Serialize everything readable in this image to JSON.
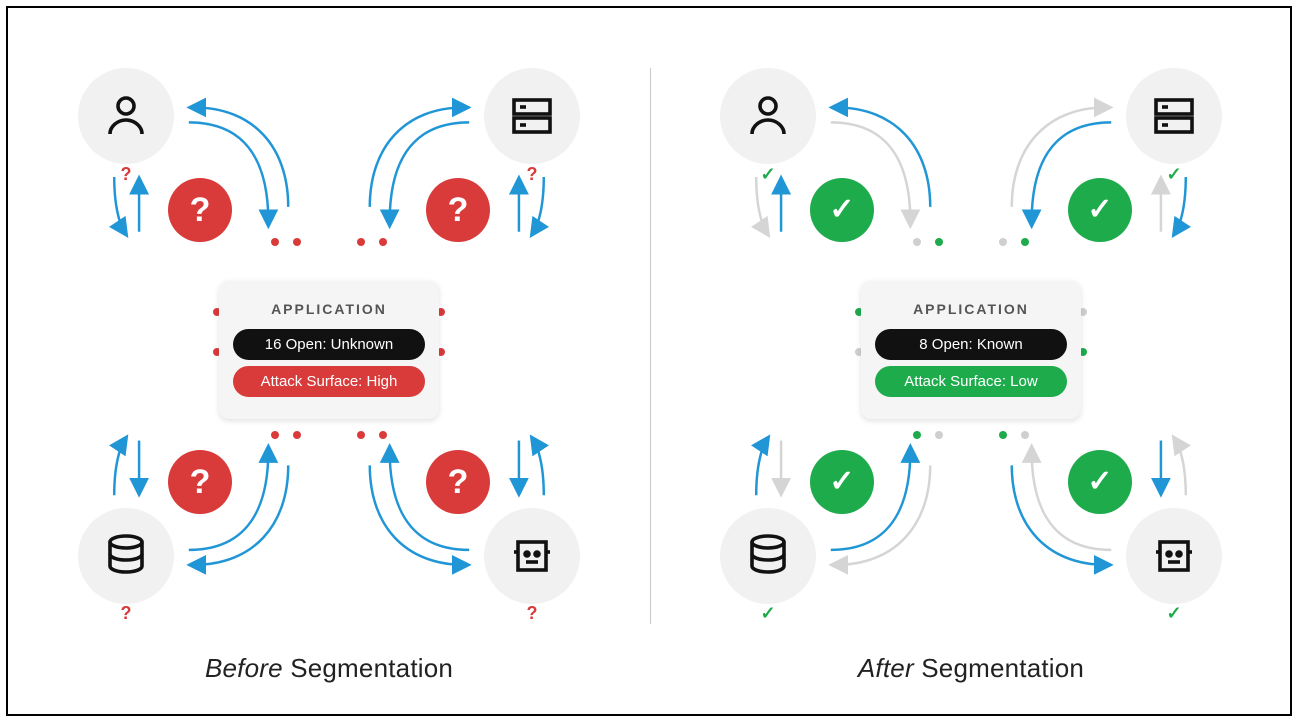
{
  "before": {
    "caption_prefix": "Before",
    "caption_rest": " Segmentation",
    "card_title": "APPLICATION",
    "pill1": "16 Open: Unknown",
    "pill2": "Attack Surface: High",
    "accent": "red",
    "sub_mark": "?",
    "badge_mark": "?",
    "nodes": {
      "tl": "user",
      "tr": "server",
      "bl": "database",
      "br": "bot"
    },
    "arrows_grey": false
  },
  "after": {
    "caption_prefix": "After",
    "caption_rest": " Segmentation",
    "card_title": "APPLICATION",
    "pill1": "8 Open: Known",
    "pill2": "Attack Surface: Low",
    "accent": "green",
    "sub_mark": "✓",
    "badge_mark": "✓",
    "nodes": {
      "tl": "user",
      "tr": "server",
      "bl": "database",
      "br": "bot"
    },
    "arrows_grey": true
  },
  "icons": {
    "user": "user-icon",
    "server": "server-icon",
    "database": "database-icon",
    "bot": "bot-icon"
  }
}
